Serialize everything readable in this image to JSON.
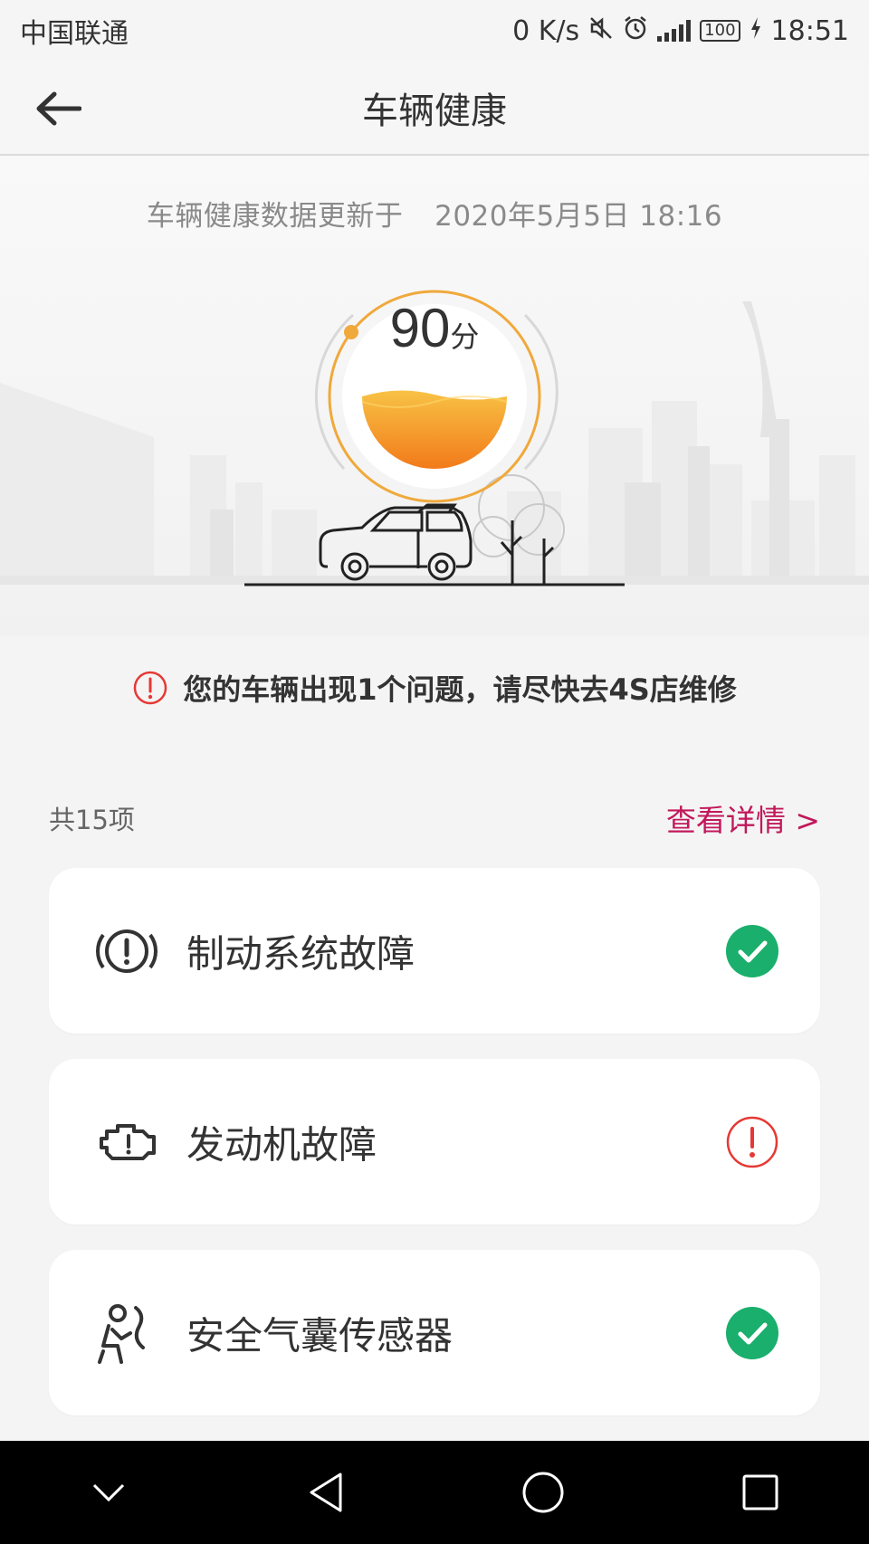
{
  "status_bar": {
    "carrier": "中国联通",
    "network_speed": "0 K/s",
    "battery": "100",
    "time": "18:51"
  },
  "header": {
    "title": "车辆健康"
  },
  "hero": {
    "update_label": "车辆健康数据更新于",
    "update_time": "2020年5月5日 18:16",
    "score": "90",
    "score_unit": "分",
    "score_value": 90,
    "score_max": 100,
    "accent_color": "#f0a93b"
  },
  "warning": {
    "text": "您的车辆出现1个问题，请尽快去4S店维修",
    "color": "#e53935"
  },
  "summary": {
    "count": "共15项",
    "details_link": "查看详情 >"
  },
  "items": [
    {
      "label": "制动系统故障",
      "icon": "brake-warning-icon",
      "status": "ok"
    },
    {
      "label": "发动机故障",
      "icon": "engine-icon",
      "status": "warning"
    },
    {
      "label": "安全气囊传感器",
      "icon": "airbag-icon",
      "status": "ok"
    }
  ],
  "colors": {
    "ok": "#1aaf6c",
    "warning": "#e53935",
    "link": "#c2185b"
  }
}
